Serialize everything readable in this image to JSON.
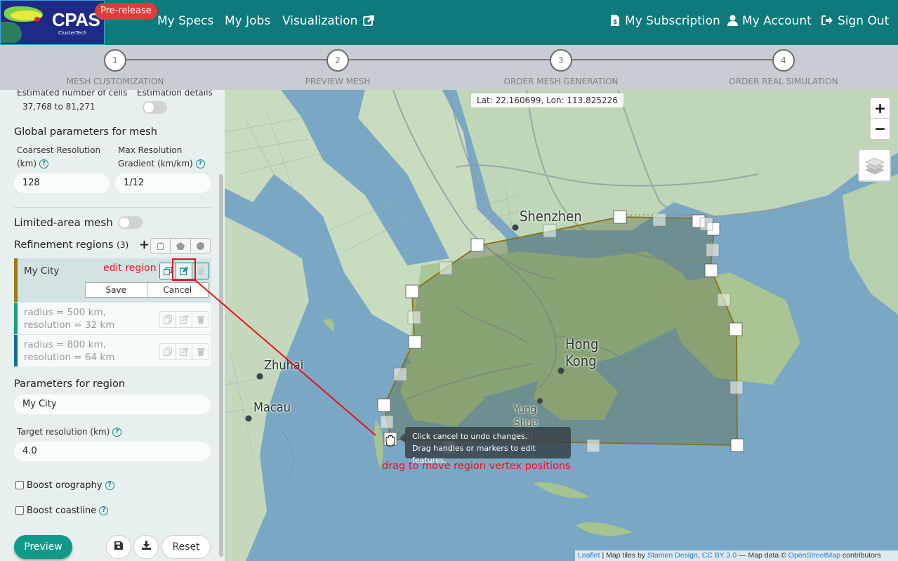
{
  "navbar": {
    "logo_text": "CPAS",
    "logo_subtext": "ClusterTech",
    "badge": "Pre-release",
    "links": [
      {
        "label": "My Specs",
        "icon": ""
      },
      {
        "label": "My Jobs",
        "icon": ""
      },
      {
        "label": "Visualization",
        "icon": "external-link-icon"
      }
    ],
    "right_links": [
      {
        "label": "My Subscription",
        "icon": "invoice-icon"
      },
      {
        "label": "My Account",
        "icon": "user-icon"
      },
      {
        "label": "Sign Out",
        "icon": "sign-out-icon"
      }
    ]
  },
  "stepper": {
    "steps": [
      {
        "number": "1",
        "label": "MESH CUSTOMIZATION"
      },
      {
        "number": "2",
        "label": "PREVIEW MESH"
      },
      {
        "number": "3",
        "label": "ORDER MESH GENERATION"
      },
      {
        "number": "4",
        "label": "ORDER REAL SIMULATION"
      }
    ]
  },
  "sidebar": {
    "estimated_cells_label": "Estimated number of cells",
    "estimated_cells_value": "37,768 to 81,271",
    "estimation_details_label": "Estimation details",
    "global_params_title": "Global parameters for mesh",
    "coarsest_label_1": "Coarsest Resolution",
    "coarsest_label_2": "(km)",
    "coarsest_value": "128",
    "gradient_label_1": "Max Resolution",
    "gradient_label_2": "Gradient (km/km)",
    "gradient_value": "1/12",
    "limited_area_label": "Limited-area mesh",
    "refinement_title": "Refinement regions",
    "refinement_count": "(3)",
    "regions": [
      {
        "name": "My City",
        "color": "#9c7a0c",
        "selected": true
      },
      {
        "name": "radius = 500 km, resolution = 32 km",
        "color": "#13a07d",
        "selected": false
      },
      {
        "name": "radius = 800 km, resolution = 64 km",
        "color": "#136f9a",
        "selected": false
      }
    ],
    "save_label": "Save",
    "cancel_label": "Cancel",
    "region_params_title": "Parameters for region",
    "region_name_value": "My City",
    "target_res_label": "Target resolution (km)",
    "target_res_value": "4.0",
    "boost_orography_label": "Boost orography",
    "boost_coastline_label": "Boost coastline",
    "preview_label": "Preview",
    "reset_label": "Reset"
  },
  "map": {
    "coord_readout": "Lat: 22.160699, Lon: 113.825226",
    "zoom_in": "+",
    "zoom_out": "−",
    "places": [
      "Shenzhen",
      "Hong Kong",
      "Zhuhai",
      "Macau",
      "Yung Shue Wan"
    ],
    "place_hk_1": "Hong",
    "place_hk_2": "Kong",
    "place_ysw_1": "Yung",
    "place_ysw_2": "Shue",
    "place_ysw_3": "Wan",
    "tooltip_line1": "Click cancel to undo changes.",
    "tooltip_line2": "Drag handles or markers to edit features.",
    "attribution": {
      "leaflet": "Leaflet",
      "sep1": " | Map tiles by ",
      "stamen": "Stamen Design",
      "sep2": ", ",
      "license": "CC BY 3.0",
      "sep3": " — Map data © ",
      "osm": "OpenStreetMap",
      "sep4": " contributors"
    }
  },
  "annotations": {
    "edit_region": "edit region",
    "drag_hint": "drag to move region vertex positions",
    "color": "#e8121b"
  },
  "colors": {
    "navbar": "#0e7a7b",
    "accent": "#119a8a",
    "badge": "#e03a3a"
  }
}
